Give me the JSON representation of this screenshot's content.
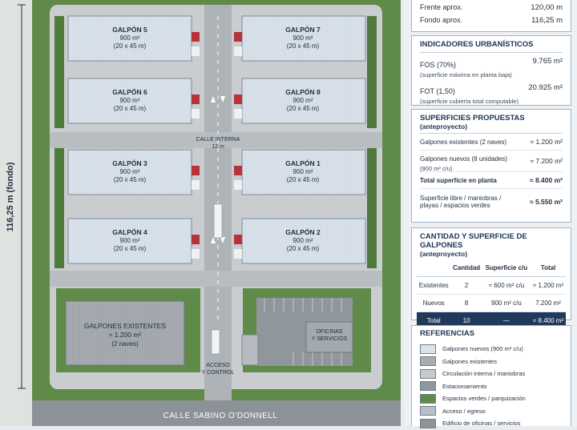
{
  "plan": {
    "bays": [
      {
        "name": "GALPÓN 5",
        "area": "900 m²",
        "dims": "(20 x 45 m)"
      },
      {
        "name": "GALPÓN 7",
        "area": "900 m²",
        "dims": "(20 x 45 m)"
      },
      {
        "name": "GALPÓN 6",
        "area": "900 m²",
        "dims": "(20 x 45 m)"
      },
      {
        "name": "GALPÓN 8",
        "area": "900 m²",
        "dims": "(20 x 45 m)"
      },
      {
        "name": "GALPÓN 3",
        "area": "900 m²",
        "dims": "(20 x 45 m)"
      },
      {
        "name": "GALPÓN 1",
        "area": "900 m²",
        "dims": "(20 x 45 m)"
      },
      {
        "name": "GALPÓN 4",
        "area": "900 m²",
        "dims": "(20 x 45 m)"
      },
      {
        "name": "GALPÓN 2",
        "area": "900 m²",
        "dims": "(20 x 45 m)"
      }
    ],
    "existing": {
      "title": "GALPONES EXISTENTES",
      "area": "≈ 1.200 m²",
      "count": "(2 naves)"
    },
    "offices": {
      "line1": "OFICINAS",
      "line2": "Y SERVICIOS"
    },
    "internal_road": {
      "line1": "CALLE INTERNA",
      "line2": "12 m"
    },
    "access": {
      "line1": "ACCESO",
      "line2": "Y CONTROL"
    },
    "street": "CALLE SABINO O'DONNELL",
    "depth_label": "116,25 m (fondo)"
  },
  "panel": {
    "dims": [
      {
        "label": "Frente aprox.",
        "value": "120,00 m"
      },
      {
        "label": "Fondo aprox.",
        "value": "116,25 m"
      }
    ],
    "urban": {
      "title": "INDICADORES URBANÍSTICOS",
      "rows": [
        {
          "label": "FOS (70%)",
          "sub": "(superficie máxima en planta baja)",
          "value": "9.765 m²"
        },
        {
          "label": "FOT (1,50)",
          "sub": "(superficie cubierta total computable)",
          "value": "20.925 m²"
        }
      ]
    },
    "surfaces": {
      "title": "SUPERFICIES PROPUESTAS",
      "subtitle": "(anteproyecto)",
      "rows": [
        {
          "label": "Galpones existentes (2 naves)",
          "value": "≈ 1.200 m²"
        },
        {
          "label": "Galpones nuevos (8 unidades)",
          "sub": "(900 m² c/u)",
          "value": "≈ 7.200 m²"
        },
        {
          "label": "Total superficie en planta",
          "value": "≈ 8.400 m²"
        },
        {
          "label": "Superficie libre / maniobras / playas / espacios verdes",
          "value": "≈ 5.550 m²"
        }
      ]
    },
    "quantity": {
      "title": "CANTIDAD Y SUPERFICIE DE GALPONES",
      "subtitle": "(anteproyecto)",
      "headers": [
        "",
        "Cantidad",
        "Superficie c/u",
        "Total"
      ],
      "rows": [
        [
          "Existentes",
          "2",
          "≈ 600 m² c/u",
          "≈ 1.200 m²"
        ],
        [
          "Nuevos",
          "8",
          "900 m² c/u",
          "7.200 m²"
        ],
        [
          "Total",
          "10",
          "—",
          "≈ 8.400 m²"
        ]
      ]
    },
    "legend": {
      "title": "REFERENCIAS",
      "items": [
        {
          "label": "Galpones nuevos (900 m² c/u)",
          "color": "#dbe3ec"
        },
        {
          "label": "Galpones existentes",
          "color": "#a7acb1"
        },
        {
          "label": "Circulación interna / maniobras",
          "color": "#c5c9cd"
        },
        {
          "label": "Estacionamiento",
          "color": "#8f969c"
        },
        {
          "label": "Espacios verdes / parquización",
          "color": "#5f8a48"
        },
        {
          "label": "Acceso / egreso",
          "color": "#b9bfc6"
        },
        {
          "label": "Edificio de oficinas / servicios",
          "color": "#8d949a"
        }
      ]
    }
  }
}
